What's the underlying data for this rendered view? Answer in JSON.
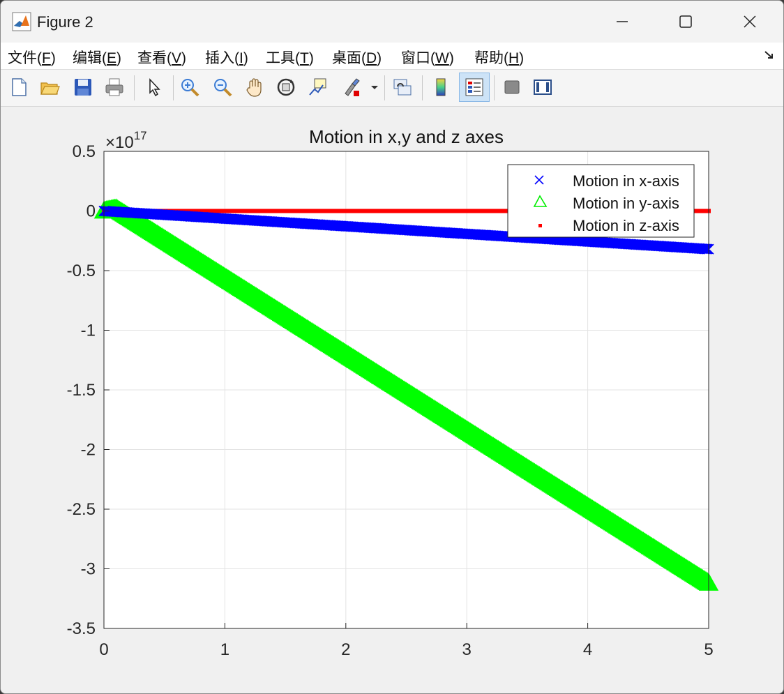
{
  "window": {
    "title": "Figure 2"
  },
  "menu": {
    "items": [
      {
        "label": "文件(",
        "key": "F",
        "tail": ")"
      },
      {
        "label": "编辑(",
        "key": "E",
        "tail": ")"
      },
      {
        "label": "查看(",
        "key": "V",
        "tail": ")"
      },
      {
        "label": "插入(",
        "key": "I",
        "tail": ")"
      },
      {
        "label": "工具(",
        "key": "T",
        "tail": ")"
      },
      {
        "label": "桌面(",
        "key": "D",
        "tail": ")"
      },
      {
        "label": "窗口(",
        "key": "W",
        "tail": ")"
      },
      {
        "label": "帮助(",
        "key": "H",
        "tail": ")"
      }
    ]
  },
  "toolbar": {
    "icons": [
      "new-figure-icon",
      "open-file-icon",
      "save-icon",
      "print-icon",
      "pointer-icon",
      "zoom-in-icon",
      "zoom-out-icon",
      "pan-hand-icon",
      "rotate-3d-icon",
      "data-cursor-icon",
      "brush-icon",
      "link-plot-icon",
      "colorbar-icon",
      "legend-icon",
      "hide-tools-icon",
      "show-tools-icon"
    ]
  },
  "chart_data": {
    "type": "line",
    "title": "Motion in x,y and z axes",
    "exponent_label": "×10",
    "exponent_power": "17",
    "xlabel": "",
    "ylabel": "",
    "xlim": [
      0,
      5
    ],
    "ylim": [
      -3.5,
      0.5
    ],
    "xticks": [
      "0",
      "1",
      "2",
      "3",
      "4",
      "5"
    ],
    "yticks": [
      "0.5",
      "0",
      "-0.5",
      "-1",
      "-1.5",
      "-2",
      "-2.5",
      "-3",
      "-3.5"
    ],
    "grid": true,
    "legend_position": "top-right",
    "series": [
      {
        "name": "Motion in x-axis",
        "marker": "x",
        "color": "#0000ff",
        "x": [
          0,
          5
        ],
        "y": [
          0,
          -0.32
        ]
      },
      {
        "name": "Motion in y-axis",
        "marker": "triangle",
        "color": "#00ff00",
        "x": [
          0,
          0.1,
          5
        ],
        "y": [
          0,
          0.02,
          -3.12
        ]
      },
      {
        "name": "Motion in z-axis",
        "marker": "point",
        "color": "#ff0000",
        "x": [
          0,
          5
        ],
        "y": [
          0,
          0
        ]
      }
    ]
  }
}
